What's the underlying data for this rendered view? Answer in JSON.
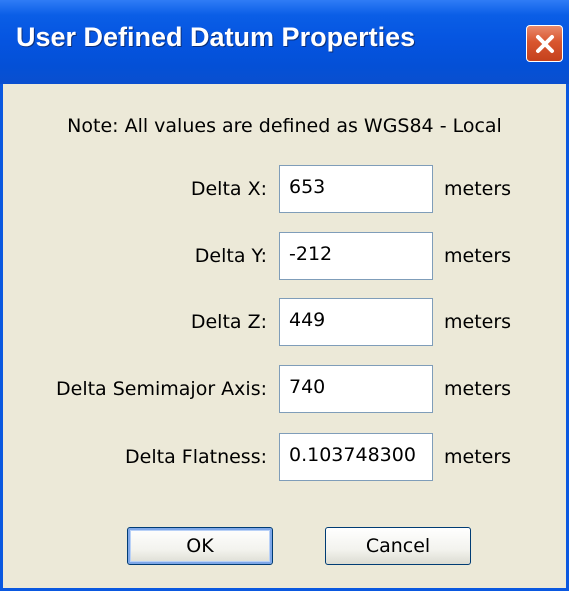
{
  "window": {
    "title": "User Defined Datum Properties",
    "close_icon": "close-x-icon"
  },
  "note": "Note: All values are defined as WGS84 - Local",
  "fields": [
    {
      "label": "Delta X:",
      "value": "653",
      "unit": "meters"
    },
    {
      "label": "Delta Y:",
      "value": "-212",
      "unit": "meters"
    },
    {
      "label": "Delta Z:",
      "value": "449",
      "unit": "meters"
    },
    {
      "label": "Delta Semimajor Axis:",
      "value": "740",
      "unit": "meters"
    },
    {
      "label": "Delta Flatness:",
      "value": "0.103748300",
      "unit": "meters"
    }
  ],
  "buttons": {
    "ok": "OK",
    "cancel": "Cancel"
  },
  "colors": {
    "titlebar": "#0554e0",
    "dialog_bg": "#ece9d8",
    "close_button": "#d9562f",
    "input_border": "#7f9db9"
  }
}
